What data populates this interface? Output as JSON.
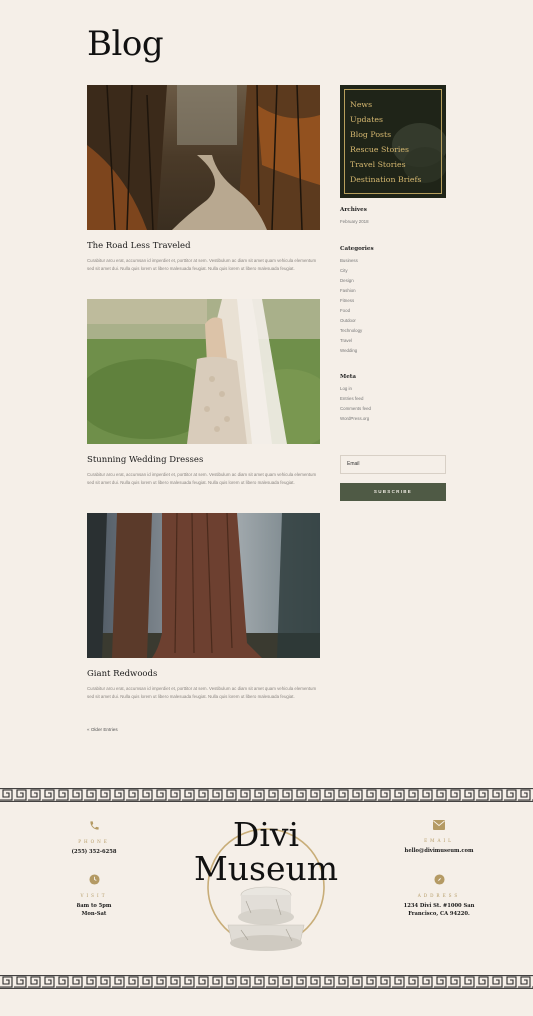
{
  "page": {
    "title": "Blog"
  },
  "posts": [
    {
      "title": "The Road Less Traveled",
      "excerpt": "Curabitur arcu erat, accumsan id imperdiet et, porttitor at sem. Vestibulum ac diam sit amet quam vehicula elementum sed sit amet dui. Nulla quis lorem ut libero malesuada feugiat. Nulla quis lorem ut libero malesuada feugiat."
    },
    {
      "title": "Stunning Wedding Dresses",
      "excerpt": "Curabitur arcu erat, accumsan id imperdiet et, porttitor at sem. Vestibulum ac diam sit amet quam vehicula elementum sed sit amet dui. Nulla quis lorem ut libero malesuada feugiat. Nulla quis lorem ut libero malesuada feugiat."
    },
    {
      "title": "Giant Redwoods",
      "excerpt": "Curabitur arcu erat, accumsan id imperdiet et, porttitor at sem. Vestibulum ac diam sit amet quam vehicula elementum sed sit amet dui. Nulla quis lorem ut libero malesuada feugiat. Nulla quis lorem ut libero malesuada feugiat."
    }
  ],
  "pagination": {
    "older": "« Older Entries"
  },
  "sidebar": {
    "menu": [
      "News",
      "Updates",
      "Blog Posts",
      "Rescue Stories",
      "Travel Stories",
      "Destination Briefs"
    ],
    "archives": {
      "heading": "Archives",
      "items": [
        "February 2018"
      ]
    },
    "categories": {
      "heading": "Categories",
      "items": [
        "Business",
        "City",
        "Design",
        "Fashion",
        "Fitness",
        "Food",
        "Outdoor",
        "Technology",
        "Travel",
        "Wedding"
      ]
    },
    "meta": {
      "heading": "Meta",
      "items": [
        "Log in",
        "Entries feed",
        "Comments feed",
        "WordPress.org"
      ]
    },
    "newsletter": {
      "email_placeholder": "Email",
      "button": "SUBSCRIBE"
    }
  },
  "footer": {
    "phone": {
      "label": "PHONE",
      "value": "(255) 352-6258"
    },
    "visit": {
      "label": "VISIT",
      "line1": "8am to 5pm",
      "line2": "Mon-Sat"
    },
    "email": {
      "label": "EMAIL",
      "value": "hello@divimuseum.com"
    },
    "address": {
      "label": "ADDRESS",
      "line1": "1234 Divi St. #1000 San",
      "line2": "Francisco, CA 94220."
    },
    "logo": {
      "line1": "Divi",
      "line2": "Museum"
    }
  },
  "colors": {
    "background": "#f5efe8",
    "accent_gold": "#b49a64",
    "button_green": "#4f5a45",
    "menu_bg": "#1f2418"
  }
}
